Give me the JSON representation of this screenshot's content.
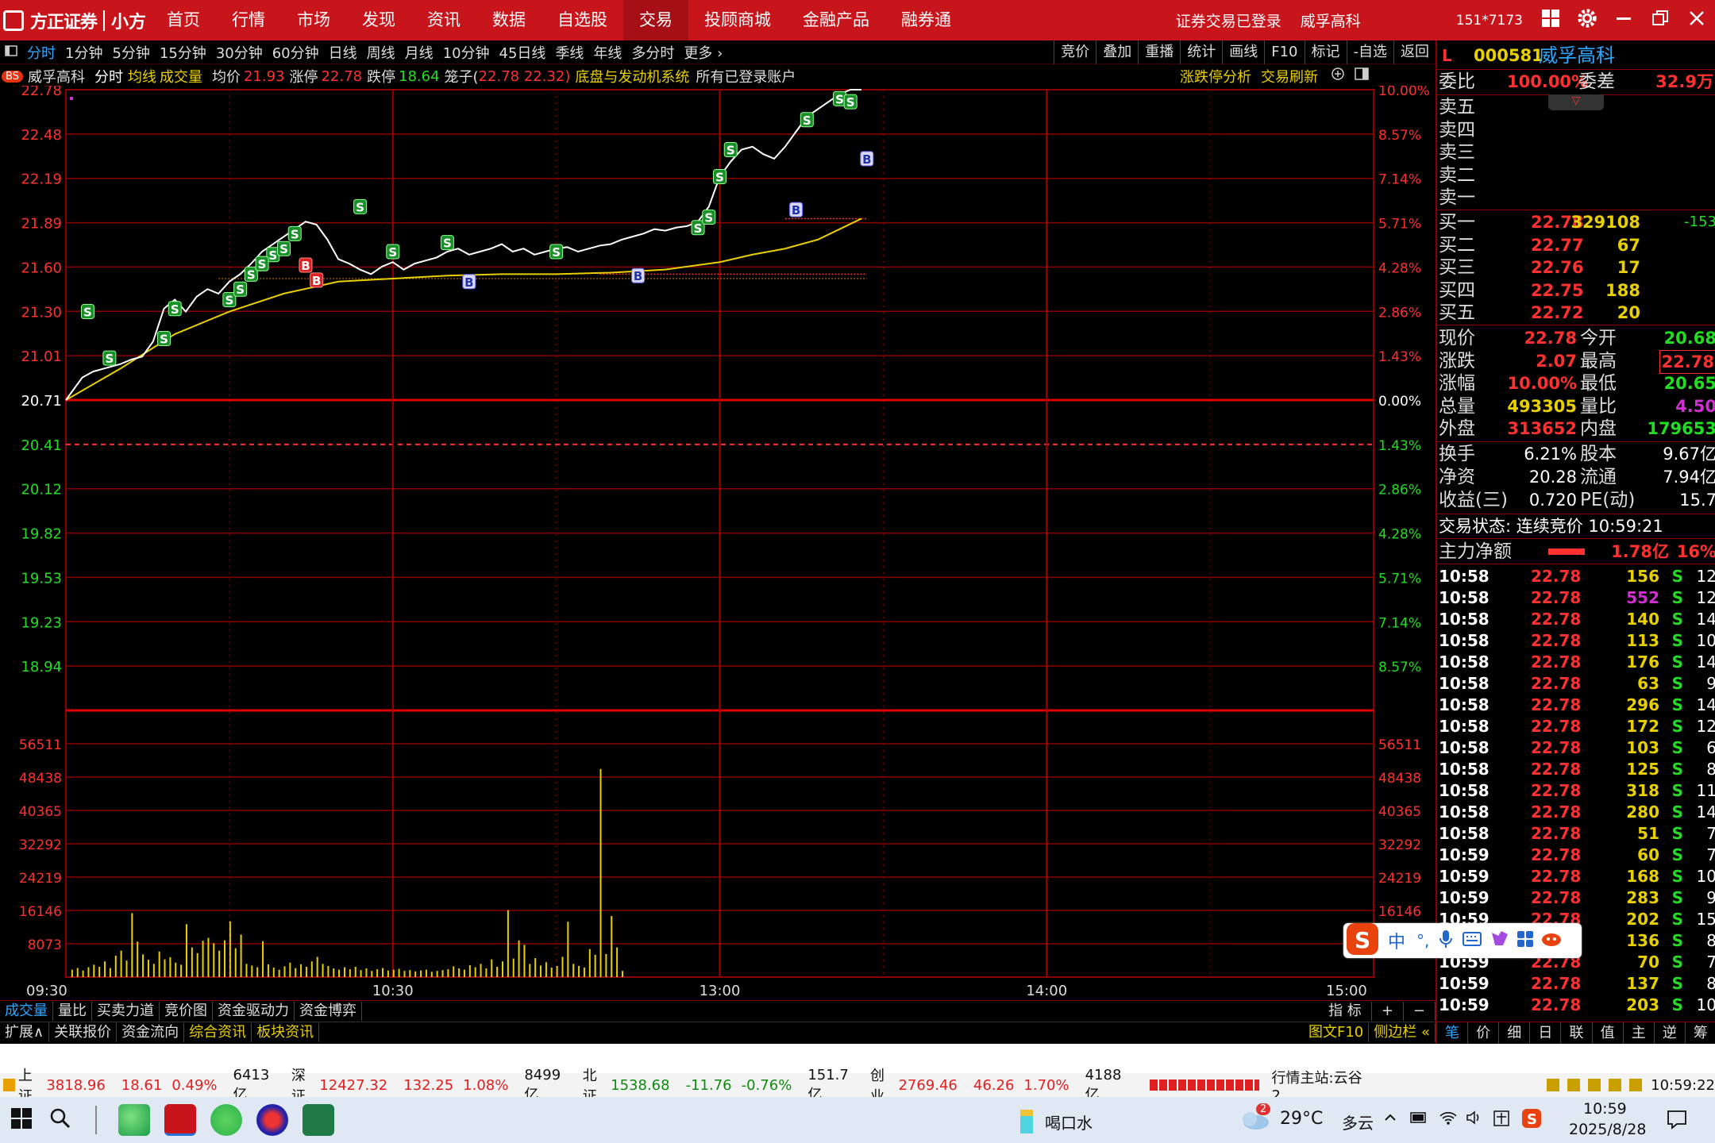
{
  "titlebar": {
    "brand": "方正证券",
    "sub_brand": "小方",
    "menu": [
      "首页",
      "行情",
      "市场",
      "发现",
      "资讯",
      "数据",
      "自选股",
      "交易",
      "投顾商城",
      "金融产品",
      "融券通"
    ],
    "active_menu": "交易",
    "account": "151*7173",
    "login_status": "证券交易已登录",
    "stock_name": "威孚高科"
  },
  "periods": [
    "分时",
    "1分钟",
    "5分钟",
    "15分钟",
    "30分钟",
    "60分钟",
    "日线",
    "周线",
    "月线",
    "10分钟",
    "45日线",
    "季线",
    "年线",
    "多分时",
    "更多 ›"
  ],
  "active_period": "分时",
  "tools": [
    "竞价",
    "叠加",
    "重播",
    "统计",
    "画线",
    "F10",
    "标记",
    "-自选",
    "返回"
  ],
  "infobar": {
    "bs_badge": "BS",
    "name": "威孚高科",
    "mode": "分时",
    "avg_line": "均线",
    "volume": "成交量",
    "avg_label": "均价",
    "avg_value": "21.93",
    "limit_up_label": "涨停",
    "limit_up_value": "22.78",
    "limit_down_label": "跌停",
    "limit_down_value": "18.64",
    "cage_label": "笼子(",
    "cage_value": "22.78 22.32)",
    "system": "底盘与发动机系统",
    "accounts": "所有已登录账户",
    "analysis": "涨跌停分析",
    "refresh": "交易刷新"
  },
  "chart_data": {
    "type": "line",
    "price_axis_left": [
      "22.78",
      "22.48",
      "22.19",
      "21.89",
      "21.60",
      "21.30",
      "21.01",
      "20.71",
      "20.41",
      "20.12",
      "19.82",
      "19.53",
      "19.23",
      "18.94"
    ],
    "price_axis_right": [
      "10.00%",
      "8.57%",
      "7.14%",
      "5.71%",
      "4.28%",
      "2.86%",
      "1.43%",
      "0.00%",
      "1.43%",
      "2.86%",
      "4.28%",
      "5.71%",
      "7.14%",
      "8.57%"
    ],
    "ylim": [
      18.64,
      22.78
    ],
    "base_price": 20.71,
    "volume_axis": [
      "56511",
      "48438",
      "40365",
      "32292",
      "24219",
      "16146",
      "8073"
    ],
    "volume_max": 64584,
    "time_labels": [
      "09:30",
      "10:30",
      "13:00",
      "14:00",
      "15:00"
    ],
    "total_minutes": 240,
    "price_series": [
      [
        0,
        20.71
      ],
      [
        3,
        20.86
      ],
      [
        5,
        20.9
      ],
      [
        8,
        20.93
      ],
      [
        10,
        20.95
      ],
      [
        12,
        20.98
      ],
      [
        14,
        21.0
      ],
      [
        16,
        21.1
      ],
      [
        18,
        21.32
      ],
      [
        20,
        21.38
      ],
      [
        22,
        21.3
      ],
      [
        24,
        21.4
      ],
      [
        26,
        21.45
      ],
      [
        28,
        21.42
      ],
      [
        30,
        21.5
      ],
      [
        32,
        21.55
      ],
      [
        34,
        21.62
      ],
      [
        36,
        21.7
      ],
      [
        38,
        21.75
      ],
      [
        40,
        21.8
      ],
      [
        42,
        21.85
      ],
      [
        44,
        21.9
      ],
      [
        46,
        21.88
      ],
      [
        48,
        21.78
      ],
      [
        50,
        21.65
      ],
      [
        52,
        21.62
      ],
      [
        54,
        21.58
      ],
      [
        56,
        21.55
      ],
      [
        58,
        21.6
      ],
      [
        60,
        21.63
      ],
      [
        62,
        21.58
      ],
      [
        64,
        21.62
      ],
      [
        66,
        21.64
      ],
      [
        68,
        21.66
      ],
      [
        70,
        21.7
      ],
      [
        72,
        21.72
      ],
      [
        74,
        21.68
      ],
      [
        76,
        21.7
      ],
      [
        78,
        21.72
      ],
      [
        80,
        21.75
      ],
      [
        82,
        21.7
      ],
      [
        84,
        21.72
      ],
      [
        86,
        21.68
      ],
      [
        88,
        21.7
      ],
      [
        90,
        21.72
      ],
      [
        92,
        21.73
      ],
      [
        94,
        21.7
      ],
      [
        96,
        21.72
      ],
      [
        98,
        21.74
      ],
      [
        100,
        21.75
      ],
      [
        102,
        21.78
      ],
      [
        104,
        21.8
      ],
      [
        106,
        21.82
      ],
      [
        108,
        21.85
      ],
      [
        110,
        21.84
      ],
      [
        112,
        21.86
      ],
      [
        114,
        21.87
      ],
      [
        116,
        21.9
      ],
      [
        118,
        22.0
      ],
      [
        120,
        22.2
      ],
      [
        122,
        22.3
      ],
      [
        124,
        22.38
      ],
      [
        126,
        22.4
      ],
      [
        128,
        22.35
      ],
      [
        130,
        22.32
      ],
      [
        132,
        22.4
      ],
      [
        134,
        22.5
      ],
      [
        136,
        22.6
      ],
      [
        138,
        22.65
      ],
      [
        140,
        22.7
      ],
      [
        142,
        22.75
      ],
      [
        144,
        22.78
      ],
      [
        146,
        22.78
      ]
    ],
    "avg_series": [
      [
        0,
        20.71
      ],
      [
        10,
        20.92
      ],
      [
        20,
        21.15
      ],
      [
        30,
        21.3
      ],
      [
        40,
        21.42
      ],
      [
        50,
        21.5
      ],
      [
        60,
        21.52
      ],
      [
        70,
        21.54
      ],
      [
        80,
        21.55
      ],
      [
        90,
        21.55
      ],
      [
        100,
        21.56
      ],
      [
        110,
        21.58
      ],
      [
        120,
        21.63
      ],
      [
        126,
        21.68
      ],
      [
        132,
        21.72
      ],
      [
        138,
        21.78
      ],
      [
        142,
        21.85
      ],
      [
        146,
        21.92
      ]
    ],
    "volumes": [
      [
        1,
        1800
      ],
      [
        2,
        2200
      ],
      [
        3,
        1600
      ],
      [
        4,
        2400
      ],
      [
        5,
        3000
      ],
      [
        6,
        2500
      ],
      [
        7,
        3800
      ],
      [
        8,
        2200
      ],
      [
        9,
        5200
      ],
      [
        10,
        6400
      ],
      [
        11,
        4000
      ],
      [
        12,
        15500
      ],
      [
        13,
        8600
      ],
      [
        14,
        5500
      ],
      [
        15,
        4200
      ],
      [
        16,
        3200
      ],
      [
        17,
        6200
      ],
      [
        18,
        4300
      ],
      [
        19,
        4800
      ],
      [
        20,
        3500
      ],
      [
        21,
        3000
      ],
      [
        22,
        12800
      ],
      [
        23,
        7200
      ],
      [
        24,
        5800
      ],
      [
        25,
        8800
      ],
      [
        26,
        9500
      ],
      [
        27,
        8200
      ],
      [
        28,
        6400
      ],
      [
        29,
        8900
      ],
      [
        30,
        13500
      ],
      [
        31,
        7000
      ],
      [
        32,
        10300
      ],
      [
        33,
        3200
      ],
      [
        34,
        2800
      ],
      [
        35,
        2400
      ],
      [
        36,
        8700
      ],
      [
        37,
        3100
      ],
      [
        38,
        2300
      ],
      [
        39,
        1800
      ],
      [
        40,
        2600
      ],
      [
        41,
        3500
      ],
      [
        42,
        2200
      ],
      [
        43,
        3100
      ],
      [
        44,
        2500
      ],
      [
        45,
        3800
      ],
      [
        46,
        4900
      ],
      [
        47,
        3200
      ],
      [
        48,
        2700
      ],
      [
        49,
        2100
      ],
      [
        50,
        1800
      ],
      [
        51,
        2400
      ],
      [
        52,
        1900
      ],
      [
        53,
        2500
      ],
      [
        54,
        1700
      ],
      [
        55,
        2100
      ],
      [
        56,
        1500
      ],
      [
        57,
        1900
      ],
      [
        58,
        2200
      ],
      [
        59,
        1600
      ],
      [
        60,
        1800
      ],
      [
        61,
        2000
      ],
      [
        62,
        1500
      ],
      [
        63,
        1700
      ],
      [
        64,
        1400
      ],
      [
        65,
        1600
      ],
      [
        66,
        1800
      ],
      [
        67,
        1300
      ],
      [
        68,
        1500
      ],
      [
        69,
        1700
      ],
      [
        70,
        1900
      ],
      [
        71,
        2600
      ],
      [
        72,
        2100
      ],
      [
        73,
        1800
      ],
      [
        74,
        2900
      ],
      [
        75,
        2400
      ],
      [
        76,
        3200
      ],
      [
        77,
        2100
      ],
      [
        78,
        4300
      ],
      [
        79,
        2500
      ],
      [
        80,
        3800
      ],
      [
        81,
        16200
      ],
      [
        82,
        4500
      ],
      [
        83,
        8900
      ],
      [
        84,
        7800
      ],
      [
        85,
        3200
      ],
      [
        86,
        4600
      ],
      [
        87,
        2800
      ],
      [
        88,
        3600
      ],
      [
        89,
        2300
      ],
      [
        90,
        2700
      ],
      [
        91,
        4900
      ],
      [
        92,
        13400
      ],
      [
        93,
        3200
      ],
      [
        94,
        2700
      ],
      [
        95,
        2300
      ],
      [
        96,
        6800
      ],
      [
        97,
        5400
      ],
      [
        98,
        50400
      ],
      [
        99,
        5600
      ],
      [
        100,
        14800
      ],
      [
        101,
        7200
      ],
      [
        102,
        1500
      ]
    ],
    "trade_marks": [
      {
        "t": 4,
        "p": 21.3,
        "s": "S"
      },
      {
        "t": 8,
        "p": 20.99,
        "s": "S"
      },
      {
        "t": 18,
        "p": 21.12,
        "s": "S"
      },
      {
        "t": 20,
        "p": 21.32,
        "s": "S"
      },
      {
        "t": 30,
        "p": 21.38,
        "s": "S"
      },
      {
        "t": 32,
        "p": 21.45,
        "s": "S"
      },
      {
        "t": 34,
        "p": 21.55,
        "s": "S"
      },
      {
        "t": 36,
        "p": 21.62,
        "s": "S"
      },
      {
        "t": 38,
        "p": 21.68,
        "s": "S"
      },
      {
        "t": 40,
        "p": 21.72,
        "s": "S"
      },
      {
        "t": 42,
        "p": 21.82,
        "s": "S"
      },
      {
        "t": 36,
        "p": 21.62,
        "s": "S"
      },
      {
        "t": 54,
        "p": 22.0,
        "s": "S"
      },
      {
        "t": 60,
        "p": 21.7,
        "s": "S"
      },
      {
        "t": 70,
        "p": 21.76,
        "s": "S"
      },
      {
        "t": 90,
        "p": 21.7,
        "s": "S"
      },
      {
        "t": 116,
        "p": 21.86,
        "s": "S"
      },
      {
        "t": 118,
        "p": 21.93,
        "s": "S"
      },
      {
        "t": 120,
        "p": 22.2,
        "s": "S"
      },
      {
        "t": 122,
        "p": 22.38,
        "s": "S"
      },
      {
        "t": 136,
        "p": 22.58,
        "s": "S"
      },
      {
        "t": 142,
        "p": 22.72,
        "s": "S"
      },
      {
        "t": 144,
        "p": 22.7,
        "s": "S"
      },
      {
        "t": 44,
        "p": 21.61,
        "s": "B"
      },
      {
        "t": 46,
        "p": 21.51,
        "s": "B"
      },
      {
        "t": 74,
        "p": 21.5,
        "s": "B"
      },
      {
        "t": 105,
        "p": 21.54,
        "s": "B"
      },
      {
        "t": 134,
        "p": 21.98,
        "s": "B"
      },
      {
        "t": 147,
        "p": 22.32,
        "s": "B"
      }
    ]
  },
  "bottom_tabs": [
    "成交量",
    "量比",
    "买卖力道",
    "竞价图",
    "资金驱动力",
    "资金博弈"
  ],
  "bottom_tabs_right": [
    "指 标",
    "+",
    "−"
  ],
  "bottom_tabs2": [
    "扩展∧",
    "关联报价",
    "资金流向",
    "综合资讯",
    "板块资讯"
  ],
  "bottom_tabs2_right": [
    "图文F10",
    "侧边栏 «"
  ],
  "quote": {
    "code": "000581",
    "name": "威孚高科",
    "weibi_label": "委比",
    "weibi": "100.00%",
    "weicha_label": "委差",
    "weicha": "32.9万",
    "sells": [
      "卖五",
      "卖四",
      "卖三",
      "卖二",
      "卖一"
    ],
    "buys": [
      {
        "label": "买一",
        "price": "22.78",
        "vol": "329108",
        "chg": "-153"
      },
      {
        "label": "买二",
        "price": "22.77",
        "vol": "67",
        "chg": ""
      },
      {
        "label": "买三",
        "price": "22.76",
        "vol": "17",
        "chg": ""
      },
      {
        "label": "买四",
        "price": "22.75",
        "vol": "188",
        "chg": ""
      },
      {
        "label": "买五",
        "price": "22.72",
        "vol": "20",
        "chg": ""
      }
    ],
    "stats1": [
      {
        "l1": "现价",
        "v1": "22.78",
        "c1": "red",
        "l2": "今开",
        "v2": "20.68",
        "c2": "green"
      },
      {
        "l1": "涨跌",
        "v1": "2.07",
        "c1": "red",
        "l2": "最高",
        "v2": "22.78",
        "c2": "red"
      },
      {
        "l1": "涨幅",
        "v1": "10.00%",
        "c1": "red",
        "l2": "最低",
        "v2": "20.65",
        "c2": "green"
      },
      {
        "l1": "总量",
        "v1": "493305",
        "c1": "yellow",
        "l2": "量比",
        "v2": "4.50",
        "c2": "magenta"
      },
      {
        "l1": "外盘",
        "v1": "313652",
        "c1": "red",
        "l2": "内盘",
        "v2": "179653",
        "c2": "green"
      }
    ],
    "stats2": [
      {
        "l1": "换手",
        "v1": "6.21%",
        "l2": "股本",
        "v2": "9.67亿"
      },
      {
        "l1": "净资",
        "v1": "20.28",
        "l2": "流通",
        "v2": "7.94亿"
      },
      {
        "l1": "收益(三)",
        "v1": "0.720",
        "l2": "PE(动)",
        "v2": "15.7"
      }
    ],
    "trade_state": "交易状态: 连续竞价 10:59:21",
    "main_flow_label": "主力净额",
    "main_flow": "1.78亿",
    "main_flow_pct": "16%",
    "ticks": [
      [
        "10:58",
        "22.78",
        "156",
        "S",
        "12"
      ],
      [
        "10:58",
        "22.78",
        "552",
        "S",
        "12"
      ],
      [
        "10:58",
        "22.78",
        "140",
        "S",
        "14"
      ],
      [
        "10:58",
        "22.78",
        "113",
        "S",
        "10"
      ],
      [
        "10:58",
        "22.78",
        "176",
        "S",
        "14"
      ],
      [
        "10:58",
        "22.78",
        "63",
        "S",
        "9"
      ],
      [
        "10:58",
        "22.78",
        "296",
        "S",
        "14"
      ],
      [
        "10:58",
        "22.78",
        "172",
        "S",
        "12"
      ],
      [
        "10:58",
        "22.78",
        "103",
        "S",
        "6"
      ],
      [
        "10:58",
        "22.78",
        "125",
        "S",
        "8"
      ],
      [
        "10:58",
        "22.78",
        "318",
        "S",
        "11"
      ],
      [
        "10:58",
        "22.78",
        "280",
        "S",
        "14"
      ],
      [
        "10:58",
        "22.78",
        "51",
        "S",
        "7"
      ],
      [
        "10:59",
        "22.78",
        "60",
        "S",
        "7"
      ],
      [
        "10:59",
        "22.78",
        "168",
        "S",
        "10"
      ],
      [
        "10:59",
        "22.78",
        "283",
        "S",
        "9"
      ],
      [
        "10:59",
        "22.78",
        "202",
        "S",
        "15"
      ],
      [
        "10:59",
        "22.78",
        "136",
        "S",
        "8"
      ],
      [
        "10:59",
        "22.78",
        "70",
        "S",
        "7"
      ],
      [
        "10:59",
        "22.78",
        "137",
        "S",
        "8"
      ],
      [
        "10:59",
        "22.78",
        "203",
        "S",
        "10"
      ]
    ],
    "side_tabs": [
      "笔",
      "价",
      "细",
      "日",
      "联",
      "值",
      "主",
      "逆",
      "筹"
    ],
    "ime": [
      "中",
      "°,"
    ]
  },
  "statusbar": {
    "items": [
      {
        "name": "上证",
        "value": "3818.96",
        "chg": "18.61",
        "pct": "0.49%",
        "amt": "6413亿",
        "up": true
      },
      {
        "name": "深证",
        "value": "12427.32",
        "chg": "132.25",
        "pct": "1.08%",
        "amt": "8499亿",
        "up": true
      },
      {
        "name": "北证",
        "value": "1538.68",
        "chg": "-11.76",
        "pct": "-0.76%",
        "amt": "151.7亿",
        "up": false
      },
      {
        "name": "创业",
        "value": "2769.46",
        "chg": "46.26",
        "pct": "1.70%",
        "amt": "4188亿",
        "up": true
      }
    ],
    "server": "行情主站:云谷2",
    "clock": "10:59:22"
  },
  "taskbar": {
    "reminder": "喝口水",
    "weather_badge": "2",
    "weather": "29°C",
    "weather_desc": "多云",
    "time": "10:59",
    "date": "2025/8/28"
  },
  "colors": {
    "brand": "#c8141b",
    "up": "#ff3030",
    "down": "#22dd22",
    "grid": "#8b0000",
    "price_line": "#ffffff",
    "avg_line": "#e8d000",
    "volume": "#e8d000"
  }
}
